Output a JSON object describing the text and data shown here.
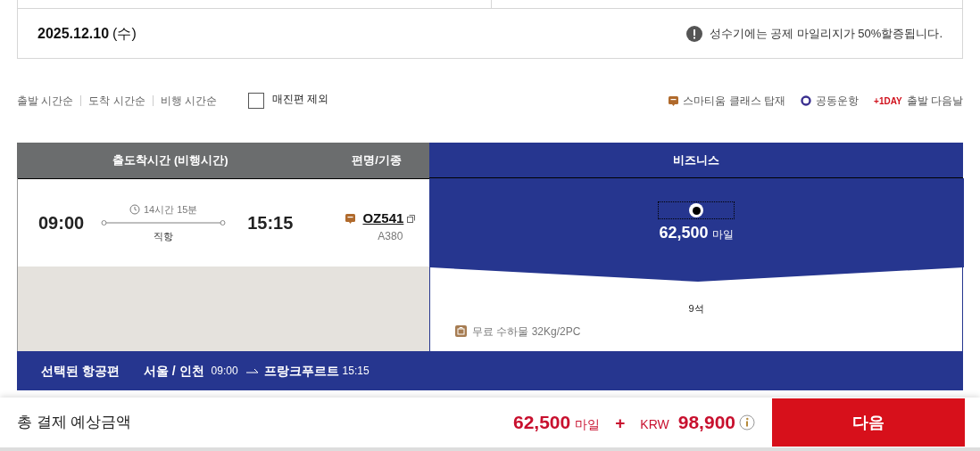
{
  "date_bar": {
    "date": "2025.12.10",
    "weekday": "(수)",
    "notice": "성수기에는 공제 마일리지가 50%할증됩니다."
  },
  "sort_options": [
    {
      "label": "출발 시간순"
    },
    {
      "label": "도착 시간순"
    },
    {
      "label": "비행 시간순"
    }
  ],
  "exclude_soldout": {
    "label": "매진편 제외",
    "checked": false
  },
  "legend": [
    {
      "kind": "smartium",
      "label": "스마티움 클래스 탑재"
    },
    {
      "kind": "codeshare",
      "label": "공동운항"
    },
    {
      "kind": "nextday",
      "badge": "+1DAY",
      "label": "출발 다음날"
    }
  ],
  "table": {
    "columns": [
      "출도착시간 (비행시간)",
      "편명/기종",
      "비즈니스"
    ],
    "rows": [
      {
        "departure": "09:00",
        "duration": "14시간 15분",
        "stops": "직항",
        "arrival": "15:15",
        "smartium": true,
        "flight": "OZ541",
        "aircraft": "A380",
        "fare": {
          "selected": true,
          "miles": "62,500",
          "unit": "마일",
          "seats": "9석",
          "baggage": "무료 수하물 32Kg/2PC"
        }
      }
    ]
  },
  "selected_flight": {
    "label": "선택된 항공편",
    "origin": "서울 / 인천",
    "dep_time": "09:00",
    "destination": "프랑크푸르트",
    "arr_time": "15:15"
  },
  "total": {
    "label": "총 결제 예상금액",
    "miles": "62,500",
    "miles_unit": "마일",
    "plus": "+",
    "currency": "KRW",
    "amount": "98,900"
  },
  "next_button": "다음"
}
